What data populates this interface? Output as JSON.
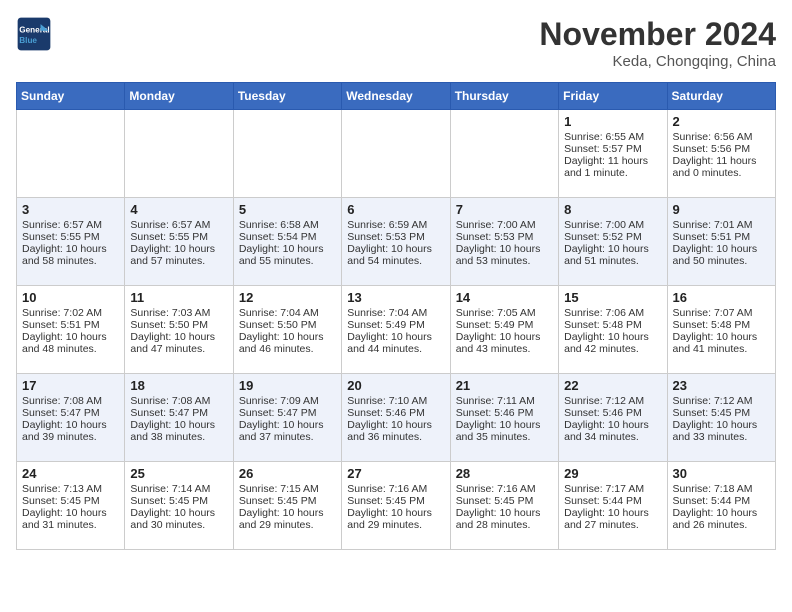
{
  "header": {
    "logo_line1": "General",
    "logo_line2": "Blue",
    "month": "November 2024",
    "location": "Keda, Chongqing, China"
  },
  "weekdays": [
    "Sunday",
    "Monday",
    "Tuesday",
    "Wednesday",
    "Thursday",
    "Friday",
    "Saturday"
  ],
  "weeks": [
    [
      {
        "day": "",
        "info": ""
      },
      {
        "day": "",
        "info": ""
      },
      {
        "day": "",
        "info": ""
      },
      {
        "day": "",
        "info": ""
      },
      {
        "day": "",
        "info": ""
      },
      {
        "day": "1",
        "info": "Sunrise: 6:55 AM\nSunset: 5:57 PM\nDaylight: 11 hours\nand 1 minute."
      },
      {
        "day": "2",
        "info": "Sunrise: 6:56 AM\nSunset: 5:56 PM\nDaylight: 11 hours\nand 0 minutes."
      }
    ],
    [
      {
        "day": "3",
        "info": "Sunrise: 6:57 AM\nSunset: 5:55 PM\nDaylight: 10 hours\nand 58 minutes."
      },
      {
        "day": "4",
        "info": "Sunrise: 6:57 AM\nSunset: 5:55 PM\nDaylight: 10 hours\nand 57 minutes."
      },
      {
        "day": "5",
        "info": "Sunrise: 6:58 AM\nSunset: 5:54 PM\nDaylight: 10 hours\nand 55 minutes."
      },
      {
        "day": "6",
        "info": "Sunrise: 6:59 AM\nSunset: 5:53 PM\nDaylight: 10 hours\nand 54 minutes."
      },
      {
        "day": "7",
        "info": "Sunrise: 7:00 AM\nSunset: 5:53 PM\nDaylight: 10 hours\nand 53 minutes."
      },
      {
        "day": "8",
        "info": "Sunrise: 7:00 AM\nSunset: 5:52 PM\nDaylight: 10 hours\nand 51 minutes."
      },
      {
        "day": "9",
        "info": "Sunrise: 7:01 AM\nSunset: 5:51 PM\nDaylight: 10 hours\nand 50 minutes."
      }
    ],
    [
      {
        "day": "10",
        "info": "Sunrise: 7:02 AM\nSunset: 5:51 PM\nDaylight: 10 hours\nand 48 minutes."
      },
      {
        "day": "11",
        "info": "Sunrise: 7:03 AM\nSunset: 5:50 PM\nDaylight: 10 hours\nand 47 minutes."
      },
      {
        "day": "12",
        "info": "Sunrise: 7:04 AM\nSunset: 5:50 PM\nDaylight: 10 hours\nand 46 minutes."
      },
      {
        "day": "13",
        "info": "Sunrise: 7:04 AM\nSunset: 5:49 PM\nDaylight: 10 hours\nand 44 minutes."
      },
      {
        "day": "14",
        "info": "Sunrise: 7:05 AM\nSunset: 5:49 PM\nDaylight: 10 hours\nand 43 minutes."
      },
      {
        "day": "15",
        "info": "Sunrise: 7:06 AM\nSunset: 5:48 PM\nDaylight: 10 hours\nand 42 minutes."
      },
      {
        "day": "16",
        "info": "Sunrise: 7:07 AM\nSunset: 5:48 PM\nDaylight: 10 hours\nand 41 minutes."
      }
    ],
    [
      {
        "day": "17",
        "info": "Sunrise: 7:08 AM\nSunset: 5:47 PM\nDaylight: 10 hours\nand 39 minutes."
      },
      {
        "day": "18",
        "info": "Sunrise: 7:08 AM\nSunset: 5:47 PM\nDaylight: 10 hours\nand 38 minutes."
      },
      {
        "day": "19",
        "info": "Sunrise: 7:09 AM\nSunset: 5:47 PM\nDaylight: 10 hours\nand 37 minutes."
      },
      {
        "day": "20",
        "info": "Sunrise: 7:10 AM\nSunset: 5:46 PM\nDaylight: 10 hours\nand 36 minutes."
      },
      {
        "day": "21",
        "info": "Sunrise: 7:11 AM\nSunset: 5:46 PM\nDaylight: 10 hours\nand 35 minutes."
      },
      {
        "day": "22",
        "info": "Sunrise: 7:12 AM\nSunset: 5:46 PM\nDaylight: 10 hours\nand 34 minutes."
      },
      {
        "day": "23",
        "info": "Sunrise: 7:12 AM\nSunset: 5:45 PM\nDaylight: 10 hours\nand 33 minutes."
      }
    ],
    [
      {
        "day": "24",
        "info": "Sunrise: 7:13 AM\nSunset: 5:45 PM\nDaylight: 10 hours\nand 31 minutes."
      },
      {
        "day": "25",
        "info": "Sunrise: 7:14 AM\nSunset: 5:45 PM\nDaylight: 10 hours\nand 30 minutes."
      },
      {
        "day": "26",
        "info": "Sunrise: 7:15 AM\nSunset: 5:45 PM\nDaylight: 10 hours\nand 29 minutes."
      },
      {
        "day": "27",
        "info": "Sunrise: 7:16 AM\nSunset: 5:45 PM\nDaylight: 10 hours\nand 29 minutes."
      },
      {
        "day": "28",
        "info": "Sunrise: 7:16 AM\nSunset: 5:45 PM\nDaylight: 10 hours\nand 28 minutes."
      },
      {
        "day": "29",
        "info": "Sunrise: 7:17 AM\nSunset: 5:44 PM\nDaylight: 10 hours\nand 27 minutes."
      },
      {
        "day": "30",
        "info": "Sunrise: 7:18 AM\nSunset: 5:44 PM\nDaylight: 10 hours\nand 26 minutes."
      }
    ]
  ]
}
